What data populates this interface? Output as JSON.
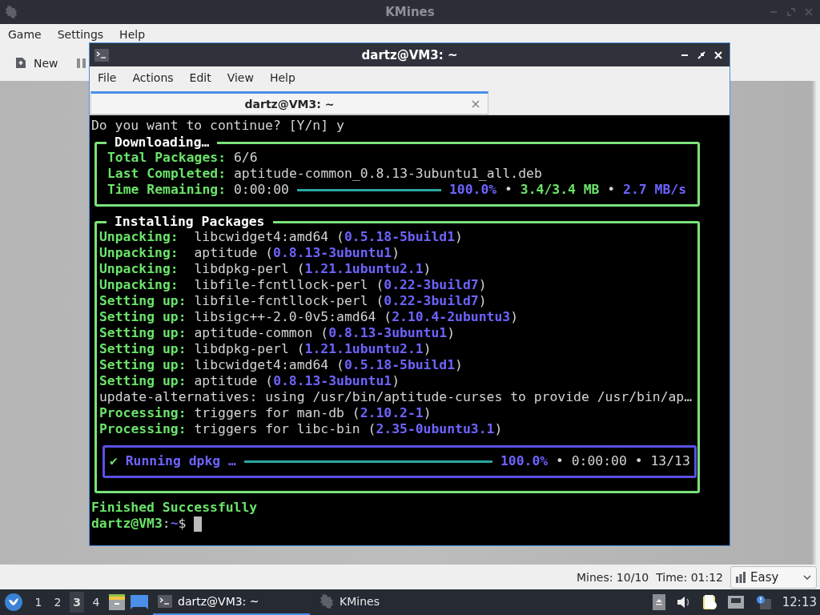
{
  "kmines": {
    "title": "KMines",
    "menu": [
      "Game",
      "Settings",
      "Help"
    ],
    "toolbar": [
      {
        "label": "New"
      }
    ],
    "status": {
      "mines": "Mines: 10/10",
      "time": "Time: 01:12",
      "difficulty": "Easy"
    }
  },
  "terminal": {
    "title": "dartz@VM3: ~",
    "menu": [
      "File",
      "Actions",
      "Edit",
      "View",
      "Help"
    ],
    "tabs": [
      {
        "label": "dartz@VM3: ~",
        "selected": true
      }
    ],
    "blocks": [
      {
        "kind": "line",
        "segments": [
          {
            "kind": "plain",
            "text": "Do you want to continue? [Y/n] y"
          }
        ]
      },
      {
        "kind": "box",
        "title": "Downloading…",
        "blocks": [
          {
            "kind": "line",
            "segments": [
              {
                "kind": "label",
                "text": "Total Packages:"
              },
              {
                "kind": "plain",
                "text": " 6/6"
              }
            ]
          },
          {
            "kind": "line",
            "segments": [
              {
                "kind": "label",
                "text": "Last Completed:"
              },
              {
                "kind": "plain",
                "text": " aptitude-common_0.8.13-3ubuntu1_all.deb"
              }
            ]
          },
          {
            "kind": "line",
            "segments": [
              {
                "kind": "label",
                "text": "Time Remaining:"
              },
              {
                "kind": "plain",
                "text": " 0:00:00"
              },
              {
                "kind": "bar",
                "level": 1.0
              },
              {
                "kind": "version",
                "text": "100.0%"
              },
              {
                "kind": "plain",
                "text": " • "
              },
              {
                "kind": "label",
                "text": "3.4/3.4 MB"
              },
              {
                "kind": "plain",
                "text": " • "
              },
              {
                "kind": "version",
                "text": "2.7 MB/s"
              }
            ]
          }
        ]
      },
      {
        "kind": "box",
        "title": "Installing Packages",
        "blocks": [
          {
            "kind": "line",
            "segments": [
              {
                "kind": "label",
                "text": "Unpacking:"
              },
              {
                "kind": "plain",
                "text": "  libcwidget4:amd64 ("
              },
              {
                "kind": "version",
                "text": "0.5.18-5build1"
              },
              {
                "kind": "plain",
                "text": ")"
              }
            ]
          },
          {
            "kind": "line",
            "segments": [
              {
                "kind": "label",
                "text": "Unpacking:"
              },
              {
                "kind": "plain",
                "text": "  aptitude ("
              },
              {
                "kind": "version",
                "text": "0.8.13-3ubuntu1"
              },
              {
                "kind": "plain",
                "text": ")"
              }
            ]
          },
          {
            "kind": "line",
            "segments": [
              {
                "kind": "label",
                "text": "Unpacking:"
              },
              {
                "kind": "plain",
                "text": "  libdpkg-perl ("
              },
              {
                "kind": "version",
                "text": "1.21.1ubuntu2.1"
              },
              {
                "kind": "plain",
                "text": ")"
              }
            ]
          },
          {
            "kind": "line",
            "segments": [
              {
                "kind": "label",
                "text": "Unpacking:"
              },
              {
                "kind": "plain",
                "text": "  libfile-fcntllock-perl ("
              },
              {
                "kind": "version",
                "text": "0.22-3build7"
              },
              {
                "kind": "plain",
                "text": ")"
              }
            ]
          },
          {
            "kind": "line",
            "segments": [
              {
                "kind": "label",
                "text": "Setting up:"
              },
              {
                "kind": "plain",
                "text": " libfile-fcntllock-perl ("
              },
              {
                "kind": "version",
                "text": "0.22-3build7"
              },
              {
                "kind": "plain",
                "text": ")"
              }
            ]
          },
          {
            "kind": "line",
            "segments": [
              {
                "kind": "label",
                "text": "Setting up:"
              },
              {
                "kind": "plain",
                "text": " libsigc++-2.0-0v5:amd64 ("
              },
              {
                "kind": "version",
                "text": "2.10.4-2ubuntu3"
              },
              {
                "kind": "plain",
                "text": ")"
              }
            ]
          },
          {
            "kind": "line",
            "segments": [
              {
                "kind": "label",
                "text": "Setting up:"
              },
              {
                "kind": "plain",
                "text": " aptitude-common ("
              },
              {
                "kind": "version",
                "text": "0.8.13-3ubuntu1"
              },
              {
                "kind": "plain",
                "text": ")"
              }
            ]
          },
          {
            "kind": "line",
            "segments": [
              {
                "kind": "label",
                "text": "Setting up:"
              },
              {
                "kind": "plain",
                "text": " libdpkg-perl ("
              },
              {
                "kind": "version",
                "text": "1.21.1ubuntu2.1"
              },
              {
                "kind": "plain",
                "text": ")"
              }
            ]
          },
          {
            "kind": "line",
            "segments": [
              {
                "kind": "label",
                "text": "Setting up:"
              },
              {
                "kind": "plain",
                "text": " libcwidget4:amd64 ("
              },
              {
                "kind": "version",
                "text": "0.5.18-5build1"
              },
              {
                "kind": "plain",
                "text": ")"
              }
            ]
          },
          {
            "kind": "line",
            "segments": [
              {
                "kind": "label",
                "text": "Setting up:"
              },
              {
                "kind": "plain",
                "text": " aptitude ("
              },
              {
                "kind": "version",
                "text": "0.8.13-3ubuntu1"
              },
              {
                "kind": "plain",
                "text": ")"
              }
            ]
          },
          {
            "kind": "line",
            "segments": [
              {
                "kind": "plain",
                "text": "update-alternatives: using /usr/bin/aptitude-curses to provide /usr/bin/ap…"
              }
            ]
          },
          {
            "kind": "line",
            "segments": [
              {
                "kind": "label",
                "text": "Processing:"
              },
              {
                "kind": "plain",
                "text": " triggers for man-db ("
              },
              {
                "kind": "version",
                "text": "2.10.2-1"
              },
              {
                "kind": "plain",
                "text": ")"
              }
            ]
          },
          {
            "kind": "line",
            "segments": [
              {
                "kind": "label",
                "text": "Processing:"
              },
              {
                "kind": "plain",
                "text": " triggers for libc-bin ("
              },
              {
                "kind": "version",
                "text": "2.35-0ubuntu3.1"
              },
              {
                "kind": "plain",
                "text": ")"
              }
            ]
          },
          {
            "kind": "progress-box",
            "blocks": [
              {
                "kind": "line",
                "segments": [
                  {
                    "kind": "label",
                    "text": "✔"
                  },
                  {
                    "kind": "version",
                    "text": " Running dpkg …"
                  },
                  {
                    "kind": "bar",
                    "level": 1.0
                  },
                  {
                    "kind": "version",
                    "text": "100.0%"
                  },
                  {
                    "kind": "plain",
                    "text": " • 0:00:00 • 13/13"
                  }
                ]
              }
            ]
          }
        ]
      },
      {
        "kind": "line",
        "segments": [
          {
            "kind": "label",
            "text": "Finished Successfully"
          }
        ]
      },
      {
        "kind": "line",
        "segments": [
          {
            "kind": "label",
            "text": "dartz@VM3"
          },
          {
            "kind": "plain",
            "text": ":"
          },
          {
            "kind": "version",
            "text": "~"
          },
          {
            "kind": "plain",
            "text": "$"
          },
          {
            "kind": "cursor"
          }
        ]
      }
    ]
  },
  "taskbar": {
    "workspaces": [
      {
        "label": "1",
        "selected": false
      },
      {
        "label": "2",
        "selected": false
      },
      {
        "label": "3",
        "selected": true
      },
      {
        "label": "4",
        "selected": false
      }
    ],
    "tasks": [
      {
        "label": "dartz@VM3: ~",
        "kind": "terminal",
        "selected": true
      },
      {
        "label": "KMines",
        "kind": "game",
        "selected": false
      }
    ],
    "clock": "12:13"
  }
}
